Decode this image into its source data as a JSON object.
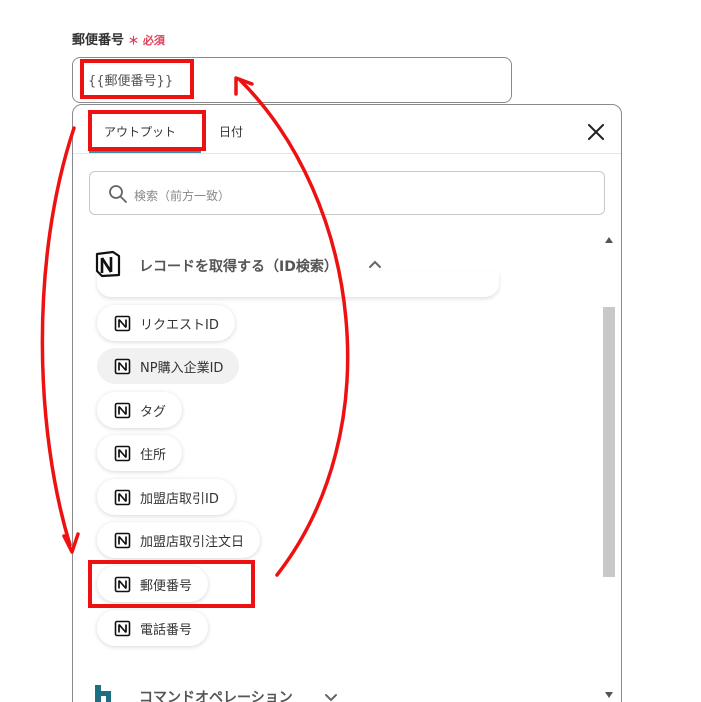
{
  "field": {
    "label": "郵便番号",
    "required_mark": "＊",
    "required_text": "必須",
    "value": "{{郵便番号}}"
  },
  "panel": {
    "tabs": [
      {
        "label": "アウトプット",
        "active": true
      },
      {
        "label": "日付",
        "active": false
      }
    ],
    "search_placeholder": "検索（前方一致）",
    "section_title": "レコードを取得する（ID検索）",
    "items": [
      {
        "label": "リクエストID"
      },
      {
        "label": "NP購入企業ID"
      },
      {
        "label": "タグ"
      },
      {
        "label": "住所"
      },
      {
        "label": "加盟店取引ID"
      },
      {
        "label": "加盟店取引注文日"
      },
      {
        "label": "郵便番号"
      },
      {
        "label": "電話番号"
      }
    ],
    "section2_title": "コマンドオペレーション"
  },
  "colors": {
    "accent": "#3a8fa8",
    "required": "#e0405a",
    "annotation": "#ee1111"
  },
  "icons": [
    "notion-icon",
    "search-icon",
    "close-icon",
    "chevron-up-icon",
    "chevron-down-icon",
    "yoom-icon"
  ]
}
